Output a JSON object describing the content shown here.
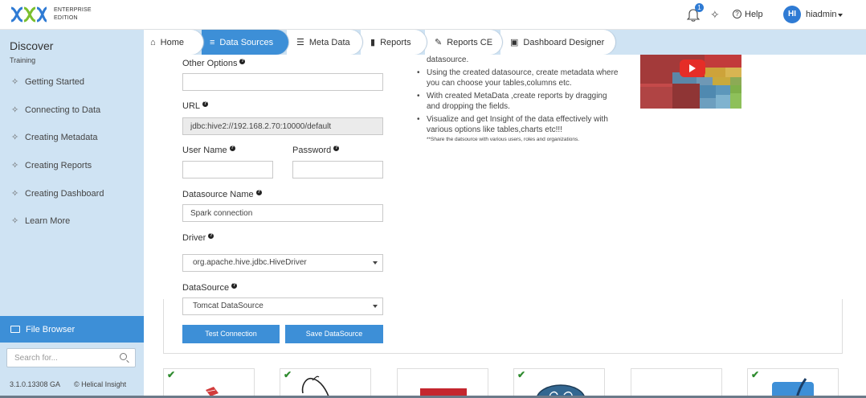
{
  "header": {
    "edition_line1": "ENTERPRISE",
    "edition_line2": "EDITION",
    "notification_count": "1",
    "help_label": "Help",
    "user_initials": "HI",
    "user_name": "hiadmin"
  },
  "sidebar": {
    "title": "Discover",
    "subtitle": "Training",
    "items": [
      {
        "label": "Getting Started"
      },
      {
        "label": "Connecting to Data"
      },
      {
        "label": "Creating Metadata"
      },
      {
        "label": "Creating Reports"
      },
      {
        "label": "Creating Dashboard"
      },
      {
        "label": "Learn More"
      }
    ],
    "file_browser_label": "File Browser",
    "search_placeholder": "Search for...",
    "version": "3.1.0.13308 GA",
    "copyright": "© Helical Insight"
  },
  "tabs": [
    {
      "label": "Home",
      "icon": "home-icon"
    },
    {
      "label": "Data Sources",
      "icon": "database-icon"
    },
    {
      "label": "Meta Data",
      "icon": "table-icon"
    },
    {
      "label": "Reports",
      "icon": "bar-chart-icon"
    },
    {
      "label": "Reports CE",
      "icon": "pencil-icon"
    },
    {
      "label": "Dashboard Designer",
      "icon": "dashboard-icon"
    }
  ],
  "form": {
    "other_options_label": "Other Options",
    "other_options_value": "",
    "url_label": "URL",
    "url_value": "jdbc:hive2://192.168.2.70:10000/default",
    "username_label": "User Name",
    "username_value": "",
    "password_label": "Password",
    "password_value": "",
    "datasource_name_label": "Datasource Name",
    "datasource_name_value": "Spark connection",
    "driver_label": "Driver",
    "driver_value": "org.apache.hive.jdbc.HiveDriver",
    "datasource_label": "DataSource",
    "datasource_value": "Tomcat DataSource",
    "test_button": "Test Connection",
    "save_button": "Save DataSource"
  },
  "info": {
    "first_line": "datasource.",
    "bullets": [
      "Using the created datasource, create metadata where you can choose your tables,columns etc.",
      "With created MetaData ,create reports by dragging and dropping the fields.",
      "Visualize and get Insight of the data effectively with various options like tables,charts etc!!!"
    ],
    "note": "**Share the datsource with various users, roles and organizations."
  },
  "colors": {
    "accent": "#3d8fd7",
    "sidebar_bg": "#cfe3f3",
    "check_green": "#2e8b2e"
  }
}
